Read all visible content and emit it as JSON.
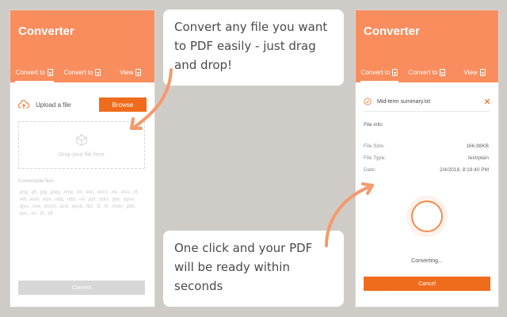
{
  "left_panel": {
    "title": "Converter",
    "tabs": [
      {
        "label": "Convert to",
        "icon": "pdf-file-icon",
        "active": true
      },
      {
        "label": "Convert to",
        "icon": "pdf-file-icon",
        "active": false
      },
      {
        "label": "View",
        "icon": "pdf-file-icon",
        "active": false
      }
    ],
    "upload_label": "Upload a file",
    "browse_label": "Browse",
    "drop_label": "Drop your file here",
    "convertable_title": "Convertable files:",
    "convertable_list": ".png, .gif, .jpg, .jpeg, .bmp, .txt, .doc, .docx, .xls, .xlsx, .rtf, .odt, .wpd, .wps, .odg, .odp, .sxi, .ppt, .pptx, .pps, .ppsx, .djvu, .sxw, .docm, .azw, .epub, .fb2, .lit, .lrf, .mobi, .pdb, .eps, .tcr, .tif, .tiff",
    "convert_label": "Convert"
  },
  "right_panel": {
    "title": "Converter",
    "tabs": [
      {
        "label": "Convert to",
        "icon": "pdf-file-icon",
        "active": true
      },
      {
        "label": "Convert to",
        "icon": "pdf-file-icon",
        "active": false
      },
      {
        "label": "View",
        "icon": "pdf-file-icon",
        "active": false
      }
    ],
    "file_name": "Mid-term summary.txt",
    "info_title": "File info:",
    "info": [
      {
        "label": "File Size:",
        "value": "166.88KB"
      },
      {
        "label": "File Type:",
        "value": "text/plain"
      },
      {
        "label": "Date:",
        "value": "2/4/2018, 8:18:40 PM"
      }
    ],
    "status": "Converting...",
    "cancel_label": "Cancel"
  },
  "callouts": {
    "top": "Convert any file you want to PDF easily - just drag and drop!",
    "bottom": "One click and your PDF will be ready within seconds"
  },
  "colors": {
    "header": "#f98d5e",
    "accent": "#f06c1d",
    "background": "#cfccc8"
  }
}
